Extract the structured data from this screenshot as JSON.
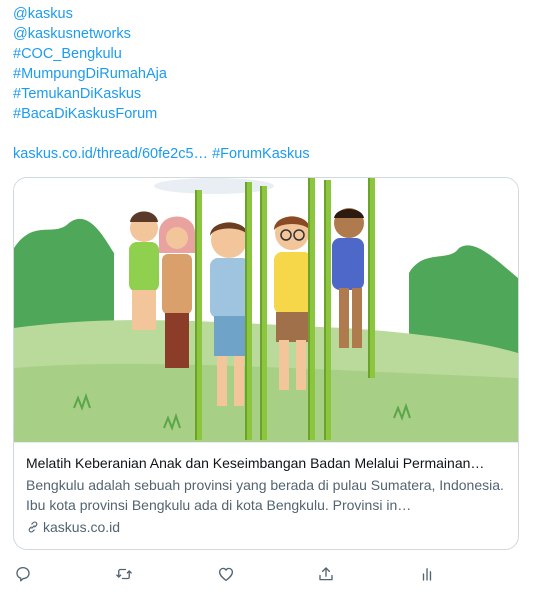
{
  "tweet": {
    "mentions": [
      "@kaskus",
      "@kaskusnetworks"
    ],
    "hashtags": [
      "#COC_Bengkulu",
      "#MumpungDiRumahAja",
      "#TemukanDiKaskus",
      "#BacaDiKaskusForum"
    ],
    "link_url_text": "kaskus.co.id/thread/60fe2c5…",
    "link_hashtag": "#ForumKaskus",
    "link_color": "#1d9bf0"
  },
  "card": {
    "image_alt": "illustration-children-playing-stilts",
    "title": "Melatih Keberanian Anak dan Keseimbangan Badan Melalui Permainan…",
    "description": "Bengkulu adalah sebuah provinsi yang berada di pulau Sumatera, Indonesia. Ibu kota provinsi Bengkulu ada di kota Bengkulu. Provinsi in…",
    "domain": "kaskus.co.id",
    "domain_icon": "link-icon"
  },
  "actions": {
    "icons": [
      "reply-icon",
      "retweet-icon",
      "like-icon",
      "share-icon",
      "analytics-icon"
    ],
    "icon_color": "#536471"
  }
}
